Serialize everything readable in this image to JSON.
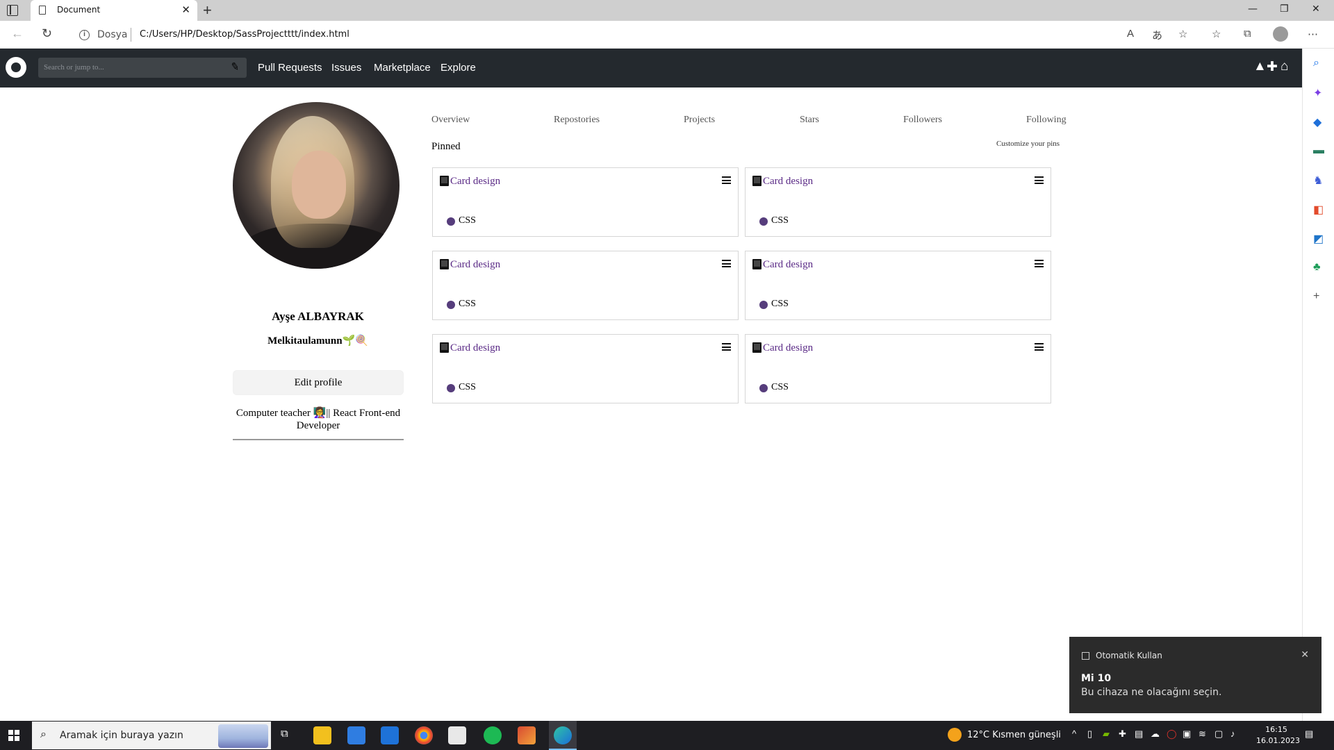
{
  "browser": {
    "tab_title": "Document",
    "close_glyph": "✕",
    "new_tab_glyph": "+",
    "address_label": "Dosya",
    "url": "C:/Users/HP/Desktop/SassProjectttt/index.html"
  },
  "github_header": {
    "search_placeholder": "Search or jump to...",
    "nav_items": [
      "Pull Requests",
      "Issues",
      "Marketplace",
      "Explore"
    ]
  },
  "profile": {
    "name": "Ayşe ALBAYRAK",
    "username": "Melkitaulamunn🌱🍭",
    "edit_button": "Edit profile",
    "bio": "Computer teacher 👩‍🏫|| React Front-end Developer"
  },
  "profile_tabs": [
    "Overview",
    "Repostories",
    "Projects",
    "Stars",
    "Followers",
    "Following"
  ],
  "pinned": {
    "title": "Pinned",
    "customize_link": "Customize your pins",
    "cards": [
      {
        "name": "Card design",
        "language": "CSS",
        "language_color": "#563d7c"
      },
      {
        "name": "Card design",
        "language": "CSS",
        "language_color": "#563d7c"
      },
      {
        "name": "Card design",
        "language": "CSS",
        "language_color": "#563d7c"
      },
      {
        "name": "Card design",
        "language": "CSS",
        "language_color": "#563d7c"
      },
      {
        "name": "Card design",
        "language": "CSS",
        "language_color": "#563d7c"
      },
      {
        "name": "Card design",
        "language": "CSS",
        "language_color": "#563d7c"
      }
    ]
  },
  "notification": {
    "app": "Otomatik Kullan",
    "title": "Mi 10",
    "body": "Bu cihaza ne olacağını seçin."
  },
  "taskbar": {
    "search_placeholder": "Aramak için buraya yazın",
    "weather": "12°C  Kısmen güneşli",
    "time": "16:15",
    "date": "16.01.2023"
  },
  "colors": {
    "github_header": "#24292e",
    "link_purple": "#5a2a86",
    "css_language": "#563d7c"
  }
}
